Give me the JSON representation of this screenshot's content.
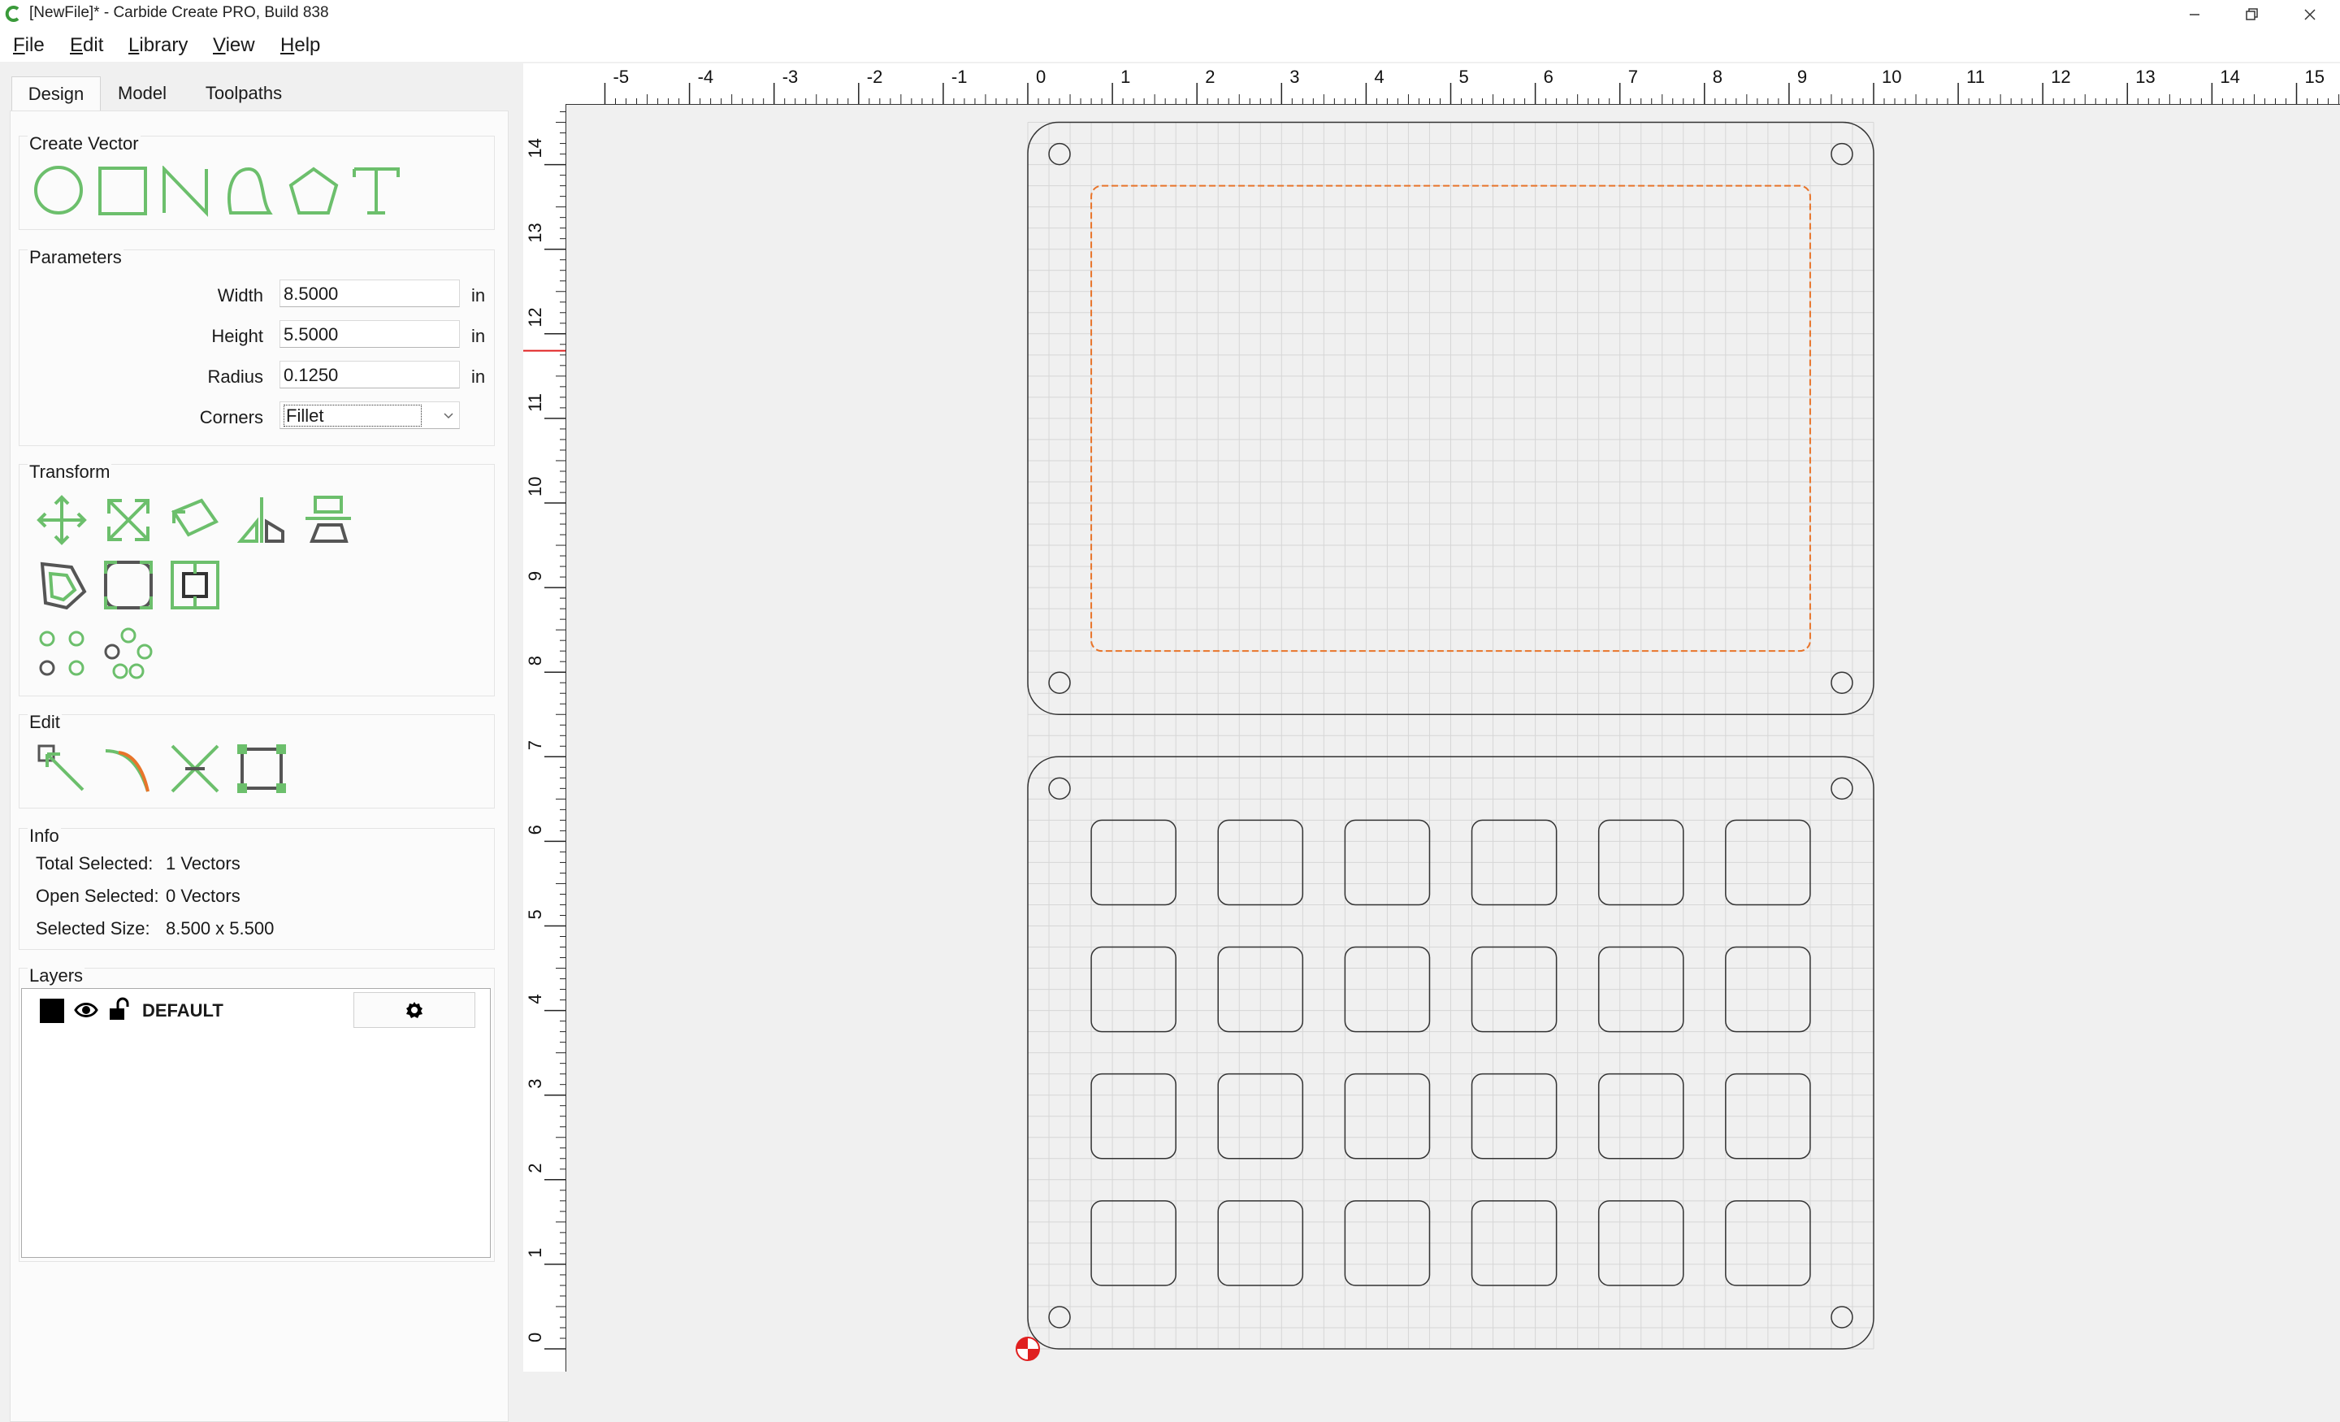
{
  "window": {
    "title": "[NewFile]* - Carbide Create PRO, Build 838",
    "controls": [
      "minimize-icon",
      "maximize-icon",
      "close-icon"
    ]
  },
  "menu": [
    "File",
    "Edit",
    "Library",
    "View",
    "Help"
  ],
  "tabs": [
    "Design",
    "Model",
    "Toolpaths"
  ],
  "create_vector": {
    "title": "Create Vector",
    "tools": [
      "circle-icon",
      "rectangle-icon",
      "polyline-icon",
      "curve-icon",
      "polygon-icon",
      "text-icon"
    ]
  },
  "parameters": {
    "title": "Parameters",
    "width_label": "Width",
    "width_value": "8.5000",
    "height_label": "Height",
    "height_value": "5.5000",
    "radius_label": "Radius",
    "radius_value": "0.1250",
    "corners_label": "Corners",
    "corners_value": "Fillet",
    "unit": "in"
  },
  "transform": {
    "title": "Transform",
    "tools": [
      "move-icon",
      "scale-icon",
      "rotate-icon",
      "mirror-icon",
      "align-icon",
      "offset-icon",
      "fillet-icon",
      "boolean-icon",
      "grid-array-icon",
      "circular-array-icon"
    ]
  },
  "edit": {
    "title": "Edit",
    "tools": [
      "node-edit-icon",
      "trim-icon",
      "cut-icon",
      "bounding-box-icon"
    ]
  },
  "info": {
    "title": "Info",
    "total_selected_label": "Total Selected:",
    "total_selected_value": "1 Vectors",
    "open_selected_label": "Open Selected:",
    "open_selected_value": "0 Vectors",
    "selected_size_label": "Selected Size:",
    "selected_size_value": "8.500 x 5.500"
  },
  "layers": {
    "title": "Layers",
    "items": [
      {
        "name": "DEFAULT",
        "color": "#000000"
      }
    ]
  },
  "rulers": {
    "horizontal": [
      "-5",
      "-4",
      "-3",
      "-2",
      "-1",
      "0",
      "1",
      "2",
      "3",
      "4",
      "5",
      "6",
      "7",
      "8",
      "9",
      "10",
      "11",
      "12",
      "13",
      "14",
      "15"
    ],
    "vertical": [
      "14",
      "13",
      "12",
      "11",
      "10",
      "9",
      "8",
      "7",
      "6",
      "5",
      "4",
      "3",
      "2",
      "1",
      "0"
    ]
  },
  "colors": {
    "tool_green": "#6cbf6c",
    "selection_orange": "#e8742a",
    "cursor_marker": "#e02020"
  }
}
